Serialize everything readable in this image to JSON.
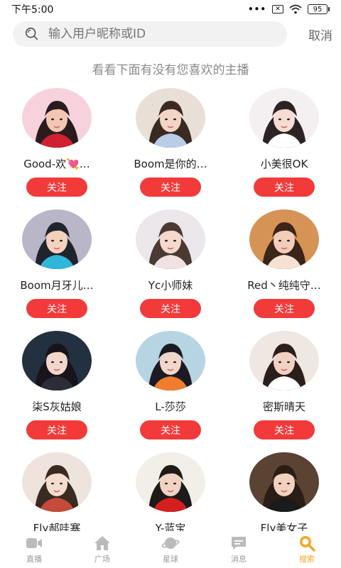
{
  "status": {
    "time": "下午5:00",
    "dots": "•••",
    "battery": "95"
  },
  "search": {
    "placeholder": "输入用户昵称或ID",
    "cancel_label": "取消"
  },
  "subtitle": "看看下面有没有您喜欢的主播",
  "follow_label": "关注",
  "anchors": [
    {
      "name": "Good-欢💘…",
      "palette": [
        "#f7d2dc",
        "#2a1c1c",
        "#f1c6b4",
        "#d1202f"
      ]
    },
    {
      "name": "Boom是你的…",
      "palette": [
        "#e8e0d6",
        "#3b2a22",
        "#f3d5c6",
        "#b9cde8"
      ]
    },
    {
      "name": "小美很OK",
      "palette": [
        "#f4eff0",
        "#2b2325",
        "#f6dcd1",
        "#ffffff"
      ]
    },
    {
      "name": "Boom月牙儿…",
      "palette": [
        "#b9b6c8",
        "#20242d",
        "#f2d2bf",
        "#2fb6d8"
      ]
    },
    {
      "name": "Yc小师妹",
      "palette": [
        "#ece7ea",
        "#4a3a33",
        "#f4d9cc",
        "#f0e2e3"
      ]
    },
    {
      "name": "Red丶纯纯守…",
      "palette": [
        "#d59355",
        "#3b2418",
        "#f2cdb9",
        "#f6e1d2"
      ]
    },
    {
      "name": "柒S灰姑娘",
      "palette": [
        "#23303f",
        "#17141a",
        "#f1d6cb",
        "#2b2d38"
      ]
    },
    {
      "name": "L-莎莎",
      "palette": [
        "#b7d4e3",
        "#1c1a22",
        "#f1d7ca",
        "#f07c2e"
      ]
    },
    {
      "name": "密斯晴天",
      "palette": [
        "#efe7e1",
        "#2c1e1b",
        "#f2d2c2",
        "#ffffff"
      ]
    },
    {
      "name": "Fly郝哇塞",
      "palette": [
        "#efe3dd",
        "#3a2a22",
        "#f4dccf",
        "#c44a3b"
      ]
    },
    {
      "name": "Y-蓝宝",
      "palette": [
        "#f2efe9",
        "#1e1a1a",
        "#f1d3c3",
        "#d41f1f"
      ]
    },
    {
      "name": "Fly美女子",
      "palette": [
        "#5a4333",
        "#2a1d16",
        "#f0d2bd",
        "#1b1b1b"
      ]
    }
  ],
  "tabs": [
    {
      "label": "直播",
      "icon": "video-icon"
    },
    {
      "label": "广场",
      "icon": "home-icon"
    },
    {
      "label": "星球",
      "icon": "planet-icon"
    },
    {
      "label": "消息",
      "icon": "message-icon"
    },
    {
      "label": "搜索",
      "icon": "search-icon",
      "active": true
    }
  ]
}
